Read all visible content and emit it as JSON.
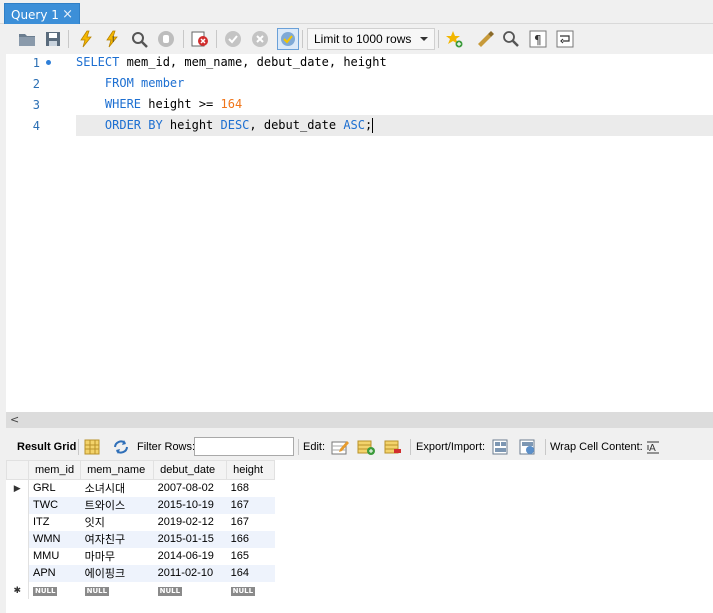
{
  "tab": {
    "label": "Query 1",
    "close": "×"
  },
  "toolbar": {
    "limit_value": "Limit to 1000 rows"
  },
  "editor": {
    "line_numbers": [
      "1",
      "2",
      "3",
      "4"
    ],
    "lines": [
      {
        "p1": "SELECT",
        "p2": " mem_id, mem_name, debut_date, height"
      },
      {
        "p1": "    FROM",
        "p2": " member"
      },
      {
        "p1": "    WHERE",
        "p2": " height >= ",
        "p3": "164"
      },
      {
        "p1": "    ORDER BY",
        "p2": " height ",
        "p3": "DESC",
        "p4": ", debut_date ",
        "p5": "ASC",
        "p6": ";"
      }
    ]
  },
  "results_toolbar": {
    "result_grid_label": "Result Grid",
    "filter_label": "Filter Rows:",
    "filter_value": "",
    "edit_label": "Edit:",
    "export_label": "Export/Import:",
    "wrap_label": "Wrap Cell Content:"
  },
  "grid": {
    "columns": [
      "mem_id",
      "mem_name",
      "debut_date",
      "height"
    ],
    "rows": [
      [
        "GRL",
        "소녀시대",
        "2007-08-02",
        "168"
      ],
      [
        "TWC",
        "트와이스",
        "2015-10-19",
        "167"
      ],
      [
        "ITZ",
        "잇지",
        "2019-02-12",
        "167"
      ],
      [
        "WMN",
        "여자친구",
        "2015-01-15",
        "166"
      ],
      [
        "MMU",
        "마마무",
        "2014-06-19",
        "165"
      ],
      [
        "APN",
        "에이핑크",
        "2011-02-10",
        "164"
      ]
    ],
    "null_label": "NULL",
    "current_row_marker": "▶",
    "new_row_marker": "✱"
  },
  "colors": {
    "tab_active": "#3c8fd8",
    "keyword": "#1d6fd1",
    "number": "#f0751a",
    "line_number": "#2b6fb4"
  },
  "icons": [
    "open-folder-icon",
    "save-icon",
    "execute-icon",
    "execute-current-icon",
    "explain-icon",
    "stop-icon",
    "toggle-error-icon",
    "commit-icon",
    "rollback-icon",
    "autocommit-icon",
    "add-snippet-icon",
    "beautify-icon",
    "find-icon",
    "invisible-chars-icon",
    "wrap-lines-icon",
    "grid-view-icon",
    "refresh-icon",
    "edit-row-icon",
    "add-row-icon",
    "delete-row-icon",
    "export-icon",
    "import-icon",
    "wrap-cell-icon"
  ]
}
